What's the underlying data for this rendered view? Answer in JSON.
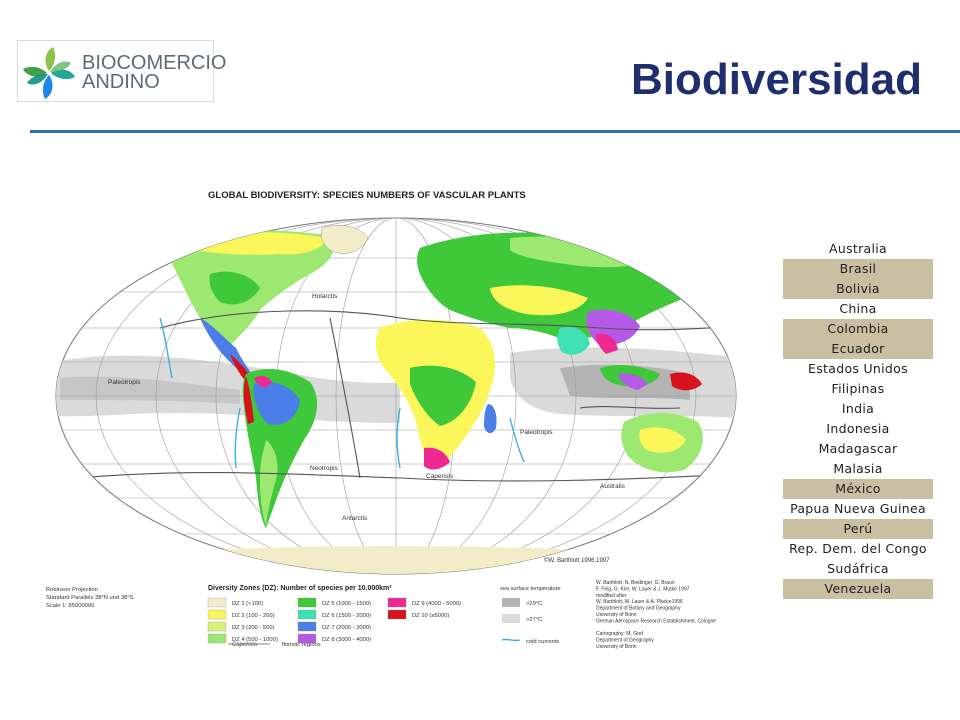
{
  "logo": {
    "line1": "BIOCOMERCIO",
    "line2": "ANDINO"
  },
  "slide": {
    "title": "Biodiversidad"
  },
  "map": {
    "title": "GLOBAL BIODIVERSITY:  SPECIES NUMBERS OF VASCULAR PLANTS",
    "region_labels": {
      "holarctis": "Holarctis",
      "paleotropis_west": "Paleotropis",
      "paleotropis_east": "Paleotropis",
      "neotropis": "Neotropis",
      "capensis": "Capensis",
      "australis": "Australis",
      "antarctis": "Antarctis"
    },
    "credit": "©W. Barthlott 1996,1997",
    "projection": [
      "Robinson Projection",
      "Standard Parallels 38°N und 38°S",
      "Scale 1: 85000000"
    ],
    "legend": {
      "heading": "Diversity Zones (DZ): Number of species per 10.000km²",
      "zones": [
        {
          "label": "DZ 1",
          "range": "(<100)",
          "color": "#f2edc8"
        },
        {
          "label": "DZ 2",
          "range": "(100 - 200)",
          "color": "#fbf65a"
        },
        {
          "label": "DZ 3",
          "range": "(200 - 500)",
          "color": "#d6f07a"
        },
        {
          "label": "DZ 4",
          "range": "(500 - 1000)",
          "color": "#9de870"
        },
        {
          "label": "DZ 5",
          "range": "(1000 - 1500)",
          "color": "#3ec83a"
        },
        {
          "label": "DZ 6",
          "range": "(1500 - 2000)",
          "color": "#3fe0b4"
        },
        {
          "label": "DZ 7",
          "range": "(2000 - 3000)",
          "color": "#4c7ee8"
        },
        {
          "label": "DZ 8",
          "range": "(3000 - 4000)",
          "color": "#b45ae6"
        },
        {
          "label": "DZ 9",
          "range": "(4000 - 5000)",
          "color": "#ee2a92"
        },
        {
          "label": "DZ 10",
          "range": "(≥5000)",
          "color": "#d8121a"
        }
      ],
      "capensis_label": "Capensis",
      "floristic_regions": "floristic regions",
      "sea_heading": "sea surface temperature",
      "sea_items": [
        {
          "label": ">29°C",
          "color": "#b4b4b4"
        },
        {
          "label": ">27°C",
          "color": "#dadada"
        }
      ],
      "cold_currents": "cold currents"
    },
    "credits": [
      "W. Barthlott, N. Biedinger, G. Braun",
      "F. Feig, G. Kier, W. Lauer & J. Mutke 1997",
      "modified after",
      "W. Barthlott, W. Lauer & A. Placke1996",
      "Department of Botany and Geography",
      "University of Bonn",
      "German Aerospace Research Establishment, Cologne",
      "",
      "Cartography: M. Gref",
      "Department of Geography",
      "University of Bonn"
    ]
  },
  "countries": [
    {
      "name": "Australia",
      "highlight": false
    },
    {
      "name": "Brasil",
      "highlight": true
    },
    {
      "name": "Bolivia",
      "highlight": true
    },
    {
      "name": "China",
      "highlight": false
    },
    {
      "name": "Colombia",
      "highlight": true
    },
    {
      "name": "Ecuador",
      "highlight": true
    },
    {
      "name": "Estados Unidos",
      "highlight": false
    },
    {
      "name": "Filipinas",
      "highlight": false
    },
    {
      "name": "India",
      "highlight": false
    },
    {
      "name": "Indonesia",
      "highlight": false
    },
    {
      "name": "Madagascar",
      "highlight": false
    },
    {
      "name": "Malasia",
      "highlight": false
    },
    {
      "name": "México",
      "highlight": true
    },
    {
      "name": "Papua Nueva Guinea",
      "highlight": false
    },
    {
      "name": "Perú",
      "highlight": true
    },
    {
      "name": "Rep. Dem. del Congo",
      "highlight": false
    },
    {
      "name": "Sudáfrica",
      "highlight": false
    },
    {
      "name": "Venezuela",
      "highlight": true
    }
  ],
  "colors": {
    "title": "#1f2f6e",
    "rule": "#2e6db4",
    "highlight_row": "#c8c0a0"
  }
}
